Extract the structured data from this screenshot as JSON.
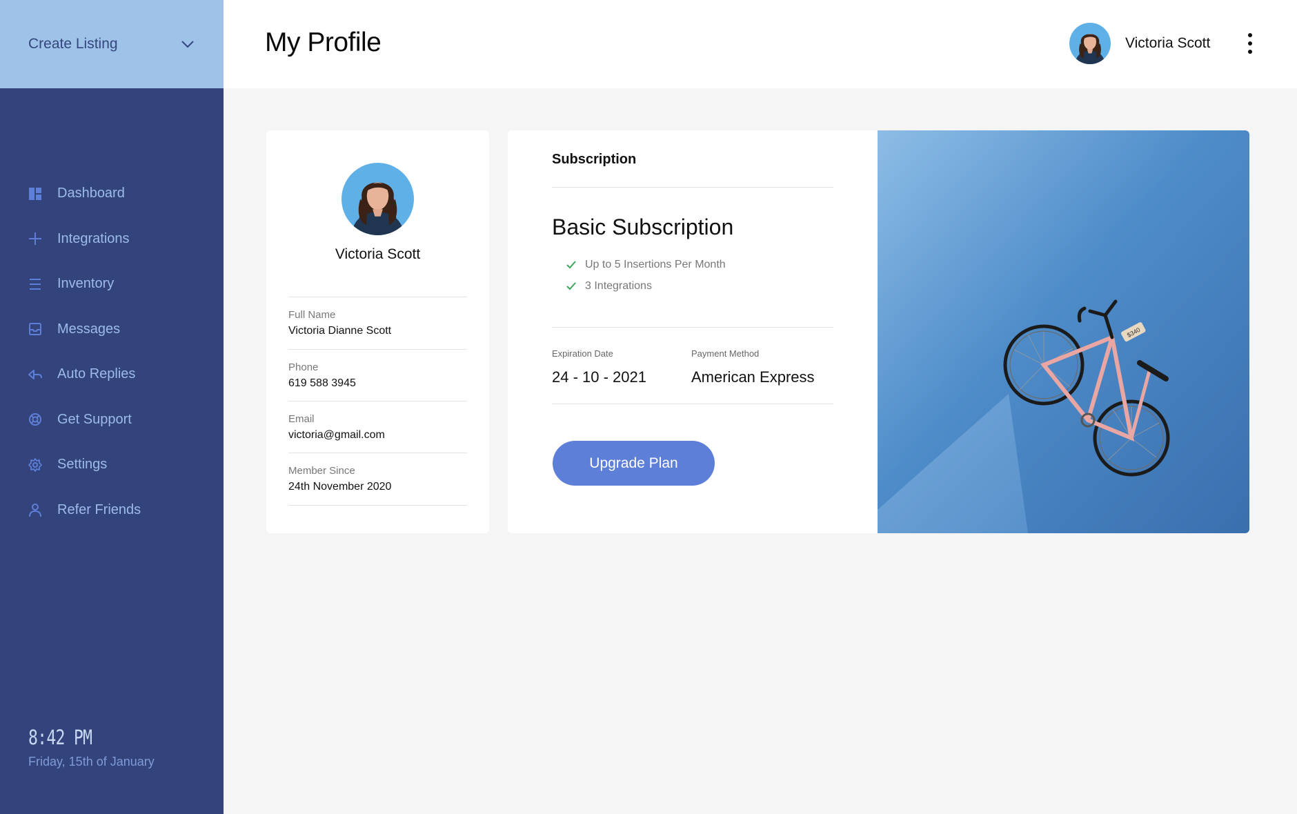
{
  "sidebar": {
    "create_listing": "Create Listing",
    "items": [
      {
        "label": "Dashboard",
        "icon": "dashboard-icon"
      },
      {
        "label": "Integrations",
        "icon": "plus-icon"
      },
      {
        "label": "Inventory",
        "icon": "list-icon"
      },
      {
        "label": "Messages",
        "icon": "inbox-icon"
      },
      {
        "label": "Auto Replies",
        "icon": "reply-icon"
      },
      {
        "label": "Get Support",
        "icon": "lifebuoy-icon"
      },
      {
        "label": "Settings",
        "icon": "gear-icon"
      },
      {
        "label": "Refer Friends",
        "icon": "user-icon"
      }
    ],
    "clock": {
      "time": "8:42 PM",
      "date": "Friday, 15th of January"
    }
  },
  "header": {
    "title": "My Profile",
    "user_name": "Victoria Scott"
  },
  "profile": {
    "name": "Victoria Scott",
    "fields": [
      {
        "label": "Full Name",
        "value": "Victoria Dianne Scott"
      },
      {
        "label": "Phone",
        "value": "619 588 3945"
      },
      {
        "label": "Email",
        "value": "victoria@gmail.com"
      },
      {
        "label": "Member Since",
        "value": "24th November 2020"
      }
    ]
  },
  "subscription": {
    "heading": "Subscription",
    "plan": "Basic Subscription",
    "features": [
      "Up to 5 Insertions Per Month",
      "3 Integrations"
    ],
    "expiration_label": "Expiration Date",
    "expiration_value": "24 - 10 - 2021",
    "payment_label": "Payment Method",
    "payment_value": "American Express",
    "upgrade_label": "Upgrade Plan",
    "bike_price_tag": "$340"
  },
  "colors": {
    "sidebar": "#33447c",
    "sidebar_top": "#9fc2e8",
    "nav_text": "#9cbbe8",
    "accent_button": "#5e7fd8",
    "check": "#3aa65a"
  }
}
